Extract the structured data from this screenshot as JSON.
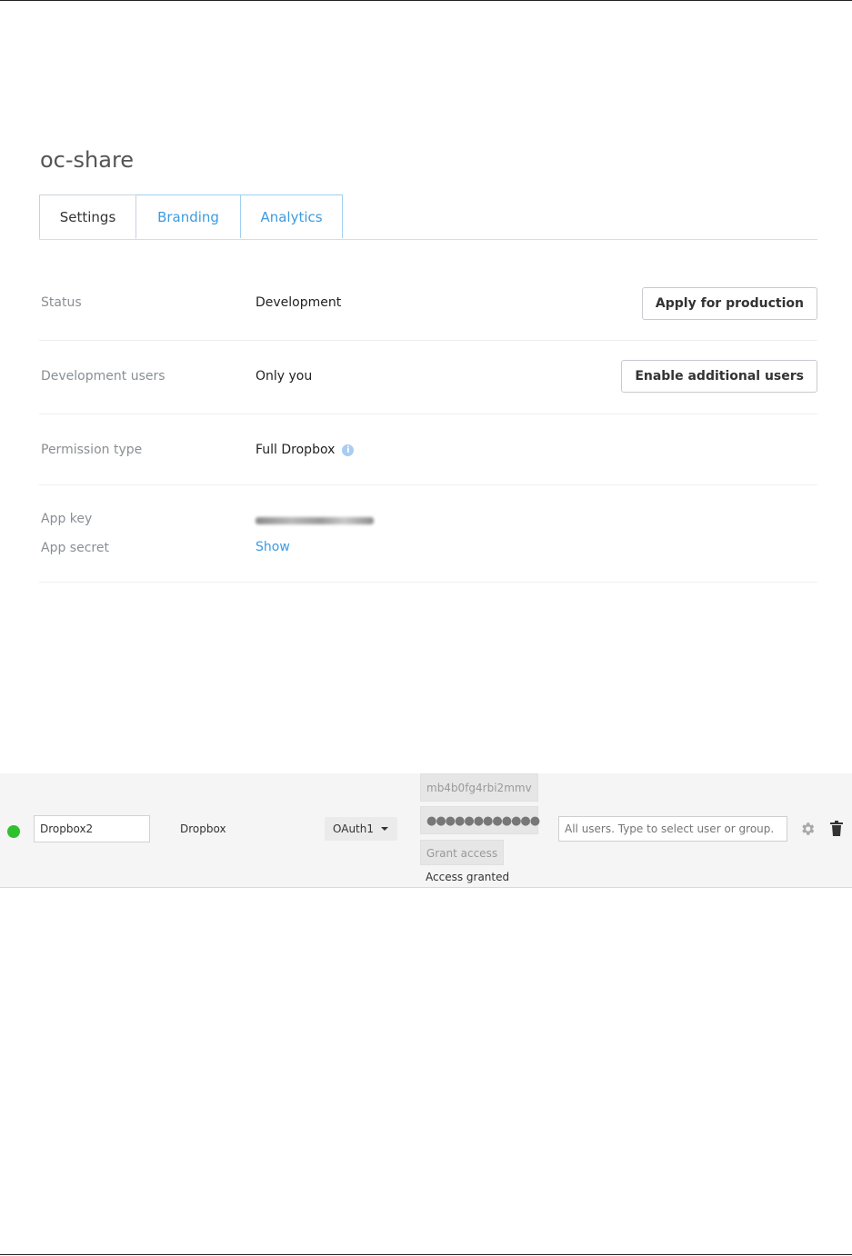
{
  "app": {
    "title": "oc-share"
  },
  "tabs": [
    {
      "label": "Settings",
      "active": true
    },
    {
      "label": "Branding",
      "active": false
    },
    {
      "label": "Analytics",
      "active": false
    }
  ],
  "settings": {
    "status": {
      "label": "Status",
      "value": "Development",
      "button": "Apply for production"
    },
    "dev_users": {
      "label": "Development users",
      "value": "Only you",
      "button": "Enable additional users"
    },
    "permission": {
      "label": "Permission type",
      "value": "Full Dropbox",
      "icon": "info-icon"
    },
    "app_key": {
      "label": "App key"
    },
    "app_secret": {
      "label": "App secret",
      "link": "Show"
    }
  },
  "storage": {
    "mount_name": "Dropbox2",
    "backend": "Dropbox",
    "auth": "OAuth1",
    "app_key": "mb4b0fg4rbi2mmv",
    "app_secret_masked": "●●●●●●●●●●●●",
    "grant_label": "Grant access",
    "access_status": "Access granted",
    "users_placeholder": "All users. Type to select user or group.",
    "status_color": "#2fc02f"
  },
  "colors": {
    "link": "#3d9be0",
    "tab_border": "#9fd0f2"
  }
}
